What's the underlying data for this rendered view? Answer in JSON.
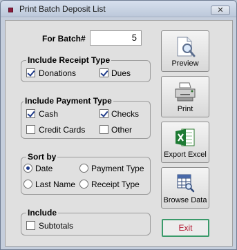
{
  "window": {
    "title": "Print Batch Deposit List",
    "close_glyph": "✕"
  },
  "batch": {
    "label": "For Batch#",
    "value": "5"
  },
  "receipt_type": {
    "title": "Include Receipt Type",
    "donations": "Donations",
    "dues": "Dues"
  },
  "payment_type": {
    "title": "Include Payment Type",
    "cash": "Cash",
    "checks": "Checks",
    "credit_cards": "Credit Cards",
    "other": "Other"
  },
  "sort_by": {
    "title": "Sort by",
    "date": "Date",
    "payment_type": "Payment Type",
    "last_name": "Last Name",
    "receipt_type": "Receipt Type"
  },
  "include": {
    "title": "Include",
    "subtotals": "Subtotals"
  },
  "buttons": {
    "preview": "Preview",
    "print": "Print",
    "export_excel": "Export Excel",
    "browse_data": "Browse Data",
    "exit": "Exit"
  },
  "icons": {
    "preview": "magnifier-document-icon",
    "print": "printer-icon",
    "export_excel": "excel-icon",
    "browse_data": "browse-grid-icon"
  }
}
